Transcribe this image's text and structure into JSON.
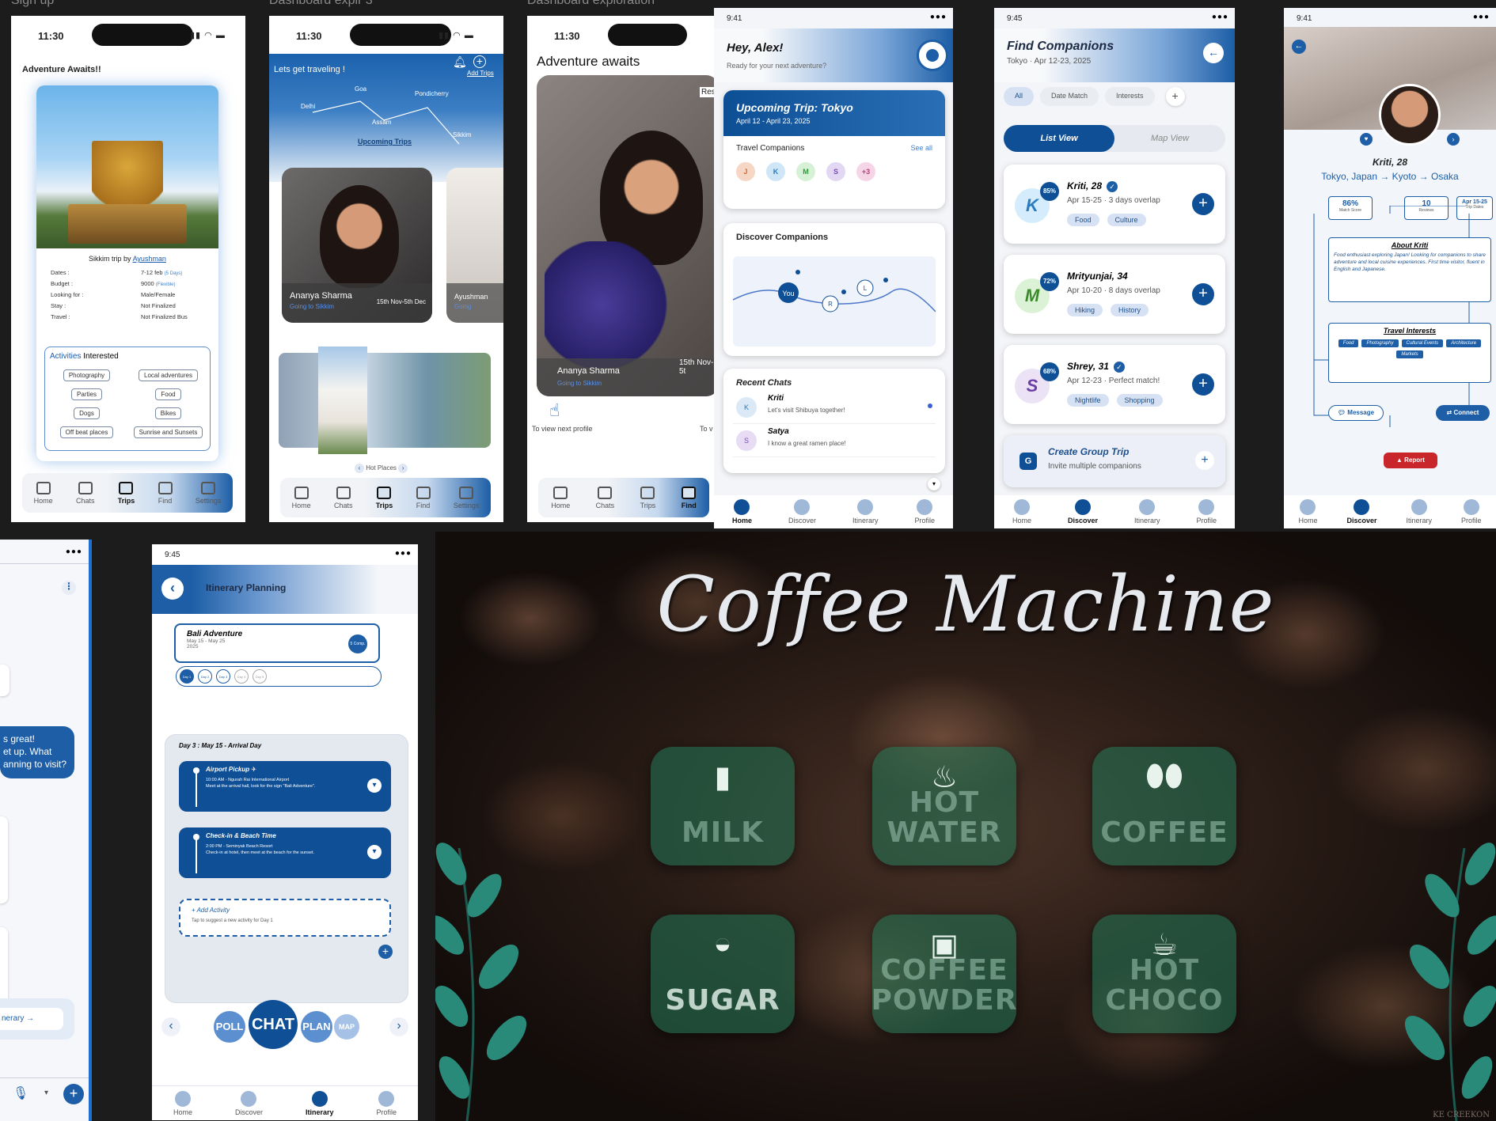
{
  "labels": {
    "signup": "Sign up",
    "dash3": "Dashboard explr 3",
    "dashExp": "Dashboard exploration"
  },
  "s1": {
    "time": "11:30",
    "heading": "Adventure Awaits!!",
    "trip_by": "Sikkim trip by",
    "trip_owner": "Ayushman",
    "rows": [
      {
        "k": "Dates :",
        "v": "7-12 feb",
        "extra": "(5 Days)"
      },
      {
        "k": "Budget :",
        "v": "9000",
        "extra": "(Flexible)"
      },
      {
        "k": "Looking for :",
        "v": "Male/Female",
        "extra": ""
      },
      {
        "k": "Stay :",
        "v": "Not Finalized",
        "extra": ""
      },
      {
        "k": "Travel :",
        "v": "Not Finalized Bus",
        "extra": ""
      }
    ],
    "activities_title": "Activities",
    "activities_sub": "Interested",
    "activities": [
      "Photography",
      "Local adventures",
      "Parties",
      "Food",
      "Dogs",
      "Bikes",
      "Off beat places",
      "Sunrise and Sunsets"
    ],
    "nav": [
      "Home",
      "Chats",
      "Trips",
      "Find",
      "Settings"
    ]
  },
  "s2": {
    "time": "11:30",
    "heading": "Lets get traveling !",
    "add_trips": "Add Trips",
    "cities": [
      "Delhi",
      "Goa",
      "Assam",
      "Pondicherry",
      "Sikkim"
    ],
    "upcoming": "Upcoming Trips",
    "card_name": "Ananya Sharma",
    "card_sub": "Going to Sikkim",
    "card_date": "15th Nov-5th Dec",
    "card2_name": "Ayushman",
    "card2_sub": "Going",
    "hot_places": "Hot Places",
    "nav": [
      "Home",
      "Chats",
      "Trips",
      "Find",
      "Settings"
    ]
  },
  "s3": {
    "time": "11:30",
    "heading": "Adventure awaits",
    "res": "Res",
    "card_name": "Ananya Sharma",
    "card_sub": "Going to Sikkim",
    "card_date": "15th Nov-5t",
    "hint": "To view next profile",
    "hint2": "To v",
    "nav": [
      "Home",
      "Chats",
      "Trips",
      "Find"
    ]
  },
  "s4": {
    "time": "9:41",
    "greet": "Hey, Alex!",
    "greet_sub": "Ready for your next adventure?",
    "trip_title": "Upcoming Trip: Tokyo",
    "trip_dates": "April 12 - April 23, 2025",
    "companions": "Travel Companions",
    "see_all": "See all",
    "avatars": [
      "J",
      "K",
      "M",
      "S",
      "+3"
    ],
    "discover": "Discover Companions",
    "map_you": "You",
    "map_r": "R",
    "map_l": "L",
    "recent": "Recent Chats",
    "chats": [
      {
        "i": "K",
        "n": "Kriti",
        "m": "Let's visit Shibuya together!"
      },
      {
        "i": "S",
        "n": "Satya",
        "m": "I know a great ramen place!"
      }
    ],
    "nav": [
      "Home",
      "Discover",
      "Itinerary",
      "Profile"
    ]
  },
  "s5": {
    "time": "9:45",
    "title": "Find Companions",
    "sub": "Tokyo · Apr 12-23, 2025",
    "filters": [
      "All",
      "Date Match",
      "Interests",
      "+"
    ],
    "views": [
      "List View",
      "Map View"
    ],
    "people": [
      {
        "i": "K",
        "pct": "85%",
        "name": "Kriti, 28",
        "dates": "Apr 15-25 · 3 days overlap",
        "tags": [
          "Food",
          "Culture"
        ]
      },
      {
        "i": "M",
        "pct": "72%",
        "name": "Mrityunjai, 34",
        "dates": "Apr 10-20 · 8 days overlap",
        "tags": [
          "Hiking",
          "History"
        ]
      },
      {
        "i": "S",
        "pct": "68%",
        "name": "Shrey, 31",
        "dates": "Apr 12-23 · Perfect match!",
        "tags": [
          "Nightlife",
          "Shopping"
        ]
      }
    ],
    "group_title": "Create Group Trip",
    "group_sub": "Invite multiple companions",
    "group_icon": "G",
    "nav": [
      "Home",
      "Discover",
      "Itinerary",
      "Profile"
    ]
  },
  "s6": {
    "time": "9:41",
    "name": "Kriti, 28",
    "route": "Tokyo, Japan → Kyoto → Osaka",
    "stats": [
      {
        "v": "86%",
        "l": "Match Score"
      },
      {
        "v": "10",
        "l": "Reviews"
      },
      {
        "v": "Apr 15-25",
        "l": "Trip Dates"
      }
    ],
    "about_title": "About Kriti",
    "about": "Food enthusiast exploring Japan! Looking for companions to share adventure and local cuisine experiences. First time visitor, fluent in English and Japanese.",
    "interests_title": "Travel Interests",
    "interests": [
      "Food",
      "Photography",
      "Cultural Events",
      "Architecture",
      "Markets"
    ],
    "message": "Message",
    "connect": "Connect",
    "report": "Report",
    "nav": [
      "Home",
      "Discover",
      "Itinerary",
      "Profile"
    ]
  },
  "s7": {
    "bubble": "s great! et up. What anning to visit?",
    "bubble_lines": [
      "s great!",
      "et up. What",
      "anning to visit?"
    ],
    "itin_btn": "nerary"
  },
  "s8": {
    "time": "9:45",
    "title": "Itinerary Planning",
    "trip": "Bali Adventure",
    "trip_dates": "May 15 - May 25",
    "trip_year": "2025",
    "trip_badge": "5 Comp.",
    "days": [
      "Day 1",
      "Day 2",
      "Day 3",
      "Day 4",
      "Day 5"
    ],
    "day_head": "Day 3 : May 15 - Arrival Day",
    "events": [
      {
        "t": "Airport Pickup ✈",
        "time": "10:00 AM - Ngurah Rai International Airport",
        "d": "Meet at the arrival hall, look for the sign \"Bali Adventure\"."
      },
      {
        "t": "Check-in & Beach Time",
        "time": "2:00 PM - Seminyak Beach Resort",
        "d": "Check-in at hotel, then meet at the beach for the sunset."
      }
    ],
    "add_title": "+ Add Activity",
    "add_sub": "Tap to suggest a new activity for Day 1",
    "modes": [
      "POLL",
      "CHAT",
      "PLAN",
      "MAP"
    ],
    "nav": [
      "Home",
      "Discover",
      "Itinerary",
      "Profile"
    ]
  },
  "coffee": {
    "title": "Coffee Machine",
    "buttons": [
      {
        "label": "MILK",
        "icon": "milk-bottle-icon"
      },
      {
        "label": "HOT WATER",
        "label2": "WATER",
        "label1": "HOT",
        "icon": "steam-cup-icon"
      },
      {
        "label": "COFFEE",
        "icon": "coffee-bean-icon"
      },
      {
        "label": "SUGAR",
        "icon": "sugar-scoop-icon"
      },
      {
        "label": "COFFEE POWDER",
        "label1": "COFFEE",
        "label2": "POWDER",
        "icon": "powder-jar-icon"
      },
      {
        "label": "HOT CHOCO",
        "label1": "HOT",
        "label2": "CHOCO",
        "icon": "mug-icon"
      }
    ],
    "watermark": "KE CREEKON"
  }
}
